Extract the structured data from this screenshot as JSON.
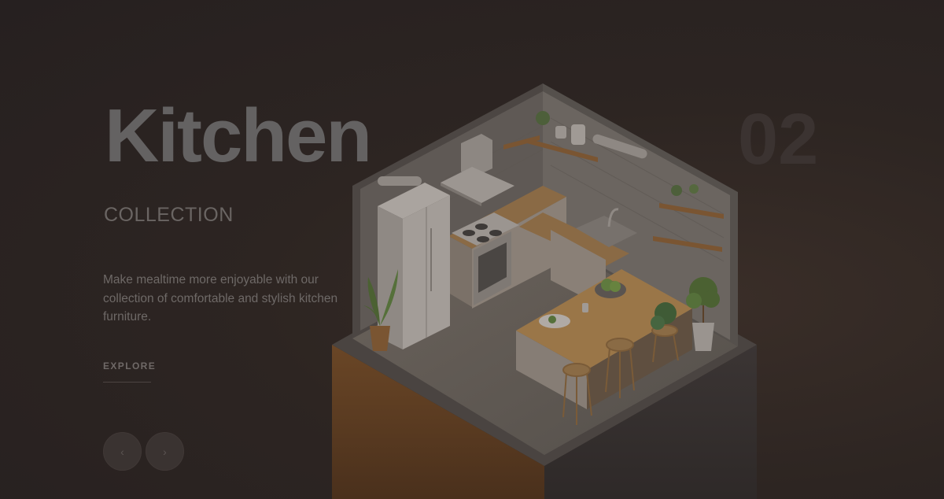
{
  "hero": {
    "title": "Kitchen",
    "subtitle": "COLLECTION",
    "slide_number": "02",
    "description": "Make mealtime more enjoyable with our collection of comfortable and stylish kitchen furniture.",
    "cta_label": "EXPLORE"
  },
  "carousel": {
    "prev_icon": "‹",
    "next_icon": "›"
  },
  "colors": {
    "background": "#2d2522",
    "title": "#646262",
    "accent_wood": "#6b4a2a"
  }
}
